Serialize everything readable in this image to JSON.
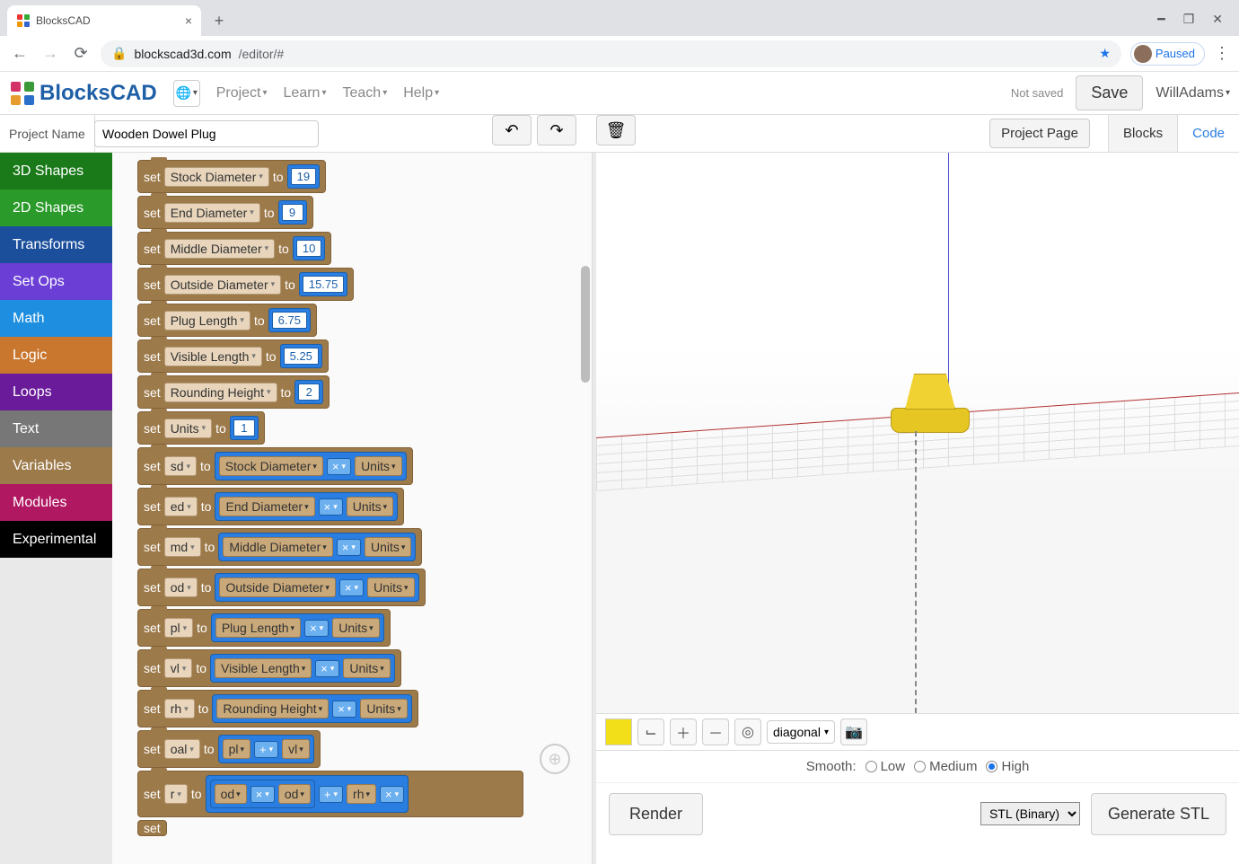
{
  "browser": {
    "tab_title": "BlocksCAD",
    "url_host": "blockscad3d.com",
    "url_path": "/editor/#",
    "profile_label": "Paused"
  },
  "header": {
    "logo_text": "BlocksCAD",
    "menu": [
      "Project",
      "Learn",
      "Teach",
      "Help"
    ],
    "not_saved": "Not saved",
    "save": "Save",
    "user": "WillAdams"
  },
  "toolbar": {
    "project_label": "Project Name",
    "project_value": "Wooden Dowel Plug",
    "project_page": "Project Page",
    "tab_blocks": "Blocks",
    "tab_code": "Code"
  },
  "categories": [
    "3D Shapes",
    "2D Shapes",
    "Transforms",
    "Set Ops",
    "Math",
    "Logic",
    "Loops",
    "Text",
    "Variables",
    "Modules",
    "Experimental"
  ],
  "blocks": {
    "set": "set",
    "to": "to",
    "vars": [
      {
        "name": "Stock Diameter",
        "val": "19"
      },
      {
        "name": "End Diameter",
        "val": "9"
      },
      {
        "name": "Middle Diameter",
        "val": "10"
      },
      {
        "name": "Outside Diameter",
        "val": "15.75"
      },
      {
        "name": "Plug Length",
        "val": "6.75"
      },
      {
        "name": "Visible Length",
        "val": "5.25"
      },
      {
        "name": "Rounding Height",
        "val": "2"
      },
      {
        "name": "Units",
        "val": "1"
      }
    ],
    "derived": [
      {
        "sv": "sd",
        "a": "Stock Diameter",
        "op": "×",
        "b": "Units"
      },
      {
        "sv": "ed",
        "a": "End Diameter",
        "op": "×",
        "b": "Units"
      },
      {
        "sv": "md",
        "a": "Middle Diameter",
        "op": "×",
        "b": "Units"
      },
      {
        "sv": "od",
        "a": "Outside Diameter",
        "op": "×",
        "b": "Units"
      },
      {
        "sv": "pl",
        "a": "Plug Length",
        "op": "×",
        "b": "Units"
      },
      {
        "sv": "vl",
        "a": "Visible Length",
        "op": "×",
        "b": "Units"
      },
      {
        "sv": "rh",
        "a": "Rounding Height",
        "op": "×",
        "b": "Units"
      }
    ],
    "oal": {
      "sv": "oal",
      "a": "pl",
      "op": "+",
      "b": "vl"
    },
    "r": {
      "sv": "r",
      "a": "od",
      "op1": "×",
      "b": "od",
      "op2": "+",
      "c": "rh",
      "op3": "×"
    }
  },
  "viewport": {
    "diagonal": "diagonal",
    "smooth_label": "Smooth:",
    "low": "Low",
    "med": "Medium",
    "high": "High",
    "render": "Render",
    "stl_format": "STL (Binary)",
    "generate": "Generate STL"
  }
}
